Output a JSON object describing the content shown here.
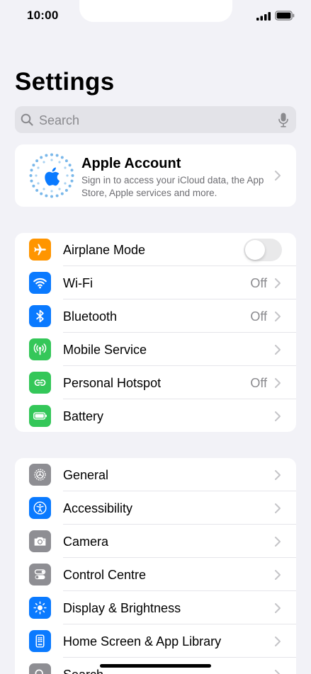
{
  "status_bar": {
    "time": "10:00"
  },
  "header": {
    "title": "Settings"
  },
  "search": {
    "placeholder": "Search"
  },
  "account": {
    "title": "Apple Account",
    "subtitle": "Sign in to access your iCloud data, the App Store, Apple services and more."
  },
  "connectivity": {
    "airplane": {
      "label": "Airplane Mode",
      "icon": "airplane-icon",
      "color": "#ff9500",
      "on": false
    },
    "wifi": {
      "label": "Wi-Fi",
      "value": "Off",
      "icon": "wifi-icon",
      "color": "#0a7aff"
    },
    "bluetooth": {
      "label": "Bluetooth",
      "value": "Off",
      "icon": "bluetooth-icon",
      "color": "#0a7aff"
    },
    "mobile": {
      "label": "Mobile Service",
      "icon": "antenna-icon",
      "color": "#34c759"
    },
    "hotspot": {
      "label": "Personal Hotspot",
      "value": "Off",
      "icon": "hotspot-icon",
      "color": "#34c759"
    },
    "battery": {
      "label": "Battery",
      "icon": "battery-icon",
      "color": "#34c759"
    }
  },
  "system": {
    "general": {
      "label": "General",
      "icon": "gear-icon",
      "color": "#8e8e93"
    },
    "accessibility": {
      "label": "Accessibility",
      "icon": "accessibility-icon",
      "color": "#0a7aff"
    },
    "camera": {
      "label": "Camera",
      "icon": "camera-icon",
      "color": "#8e8e93"
    },
    "control_centre": {
      "label": "Control Centre",
      "icon": "switches-icon",
      "color": "#8e8e93"
    },
    "display": {
      "label": "Display & Brightness",
      "icon": "sun-icon",
      "color": "#0a7aff"
    },
    "home_screen": {
      "label": "Home Screen & App Library",
      "icon": "phone-grid-icon",
      "color": "#0a7aff"
    },
    "search": {
      "label": "Search",
      "icon": "search-icon",
      "color": "#8e8e93"
    }
  }
}
